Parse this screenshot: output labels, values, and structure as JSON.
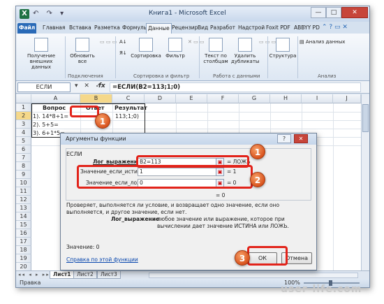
{
  "window": {
    "title": "Книга1 - Microsoft Excel",
    "app_icon_letter": "X",
    "qat_glyphs": "↶ ↷ ▾",
    "minimize": "—",
    "maximize": "□",
    "close": "✕"
  },
  "ribbon": {
    "tabs": [
      "Файл",
      "Главная",
      "Вставка",
      "Разметка",
      "Формулы",
      "Данные",
      "Рецензир",
      "Вид",
      "Разработ",
      "Надстрой",
      "Foxit PDF",
      "ABBYY PD"
    ],
    "active_tab": "Данные",
    "help_glyphs": "⌃ ? ▭ ✕",
    "buttons": {
      "get_external": "Получение внешних данных",
      "refresh_all": "Обновить все",
      "sort": "Сортировка",
      "filter": "Фильтр",
      "text_to_columns": "Текст по столбцам",
      "remove_duplicates": "Удалить дубликаты",
      "structure": "Структура",
      "data_analysis": "Анализ данных"
    },
    "groups": {
      "connections": "Подключения",
      "sort_filter": "Сортировка и фильтр",
      "data_tools": "Работа с данными",
      "analysis": "Анализ"
    }
  },
  "formula_bar": {
    "name_box": "ЕСЛИ",
    "buttons": "▾ ✕ ✓",
    "fx": "fx",
    "formula": "=ЕСЛИ(B2=113;1;0)"
  },
  "grid": {
    "columns": [
      "A",
      "B",
      "C",
      "D",
      "E",
      "F",
      "G",
      "H",
      "I",
      "J"
    ],
    "rows": [
      "1",
      "2",
      "3",
      "4",
      "5",
      "6",
      "7",
      "8",
      "9",
      "10",
      "11",
      "12",
      "13",
      "14",
      "15",
      "16",
      "17",
      "18",
      "19",
      "20"
    ],
    "header_row": {
      "a": "Вопрос",
      "b": "Ответ",
      "c": "Результат"
    },
    "cells": {
      "a2": "1). 14*8+1=",
      "c2": "113;1;0)",
      "a3": "2). 5+5=",
      "a4": "3). 6+1*5="
    }
  },
  "sheets": {
    "nav": "◂◂ ◂ ▸ ▸▸",
    "tabs": [
      "Лист1",
      "Лист2",
      "Лист3"
    ]
  },
  "status_bar": {
    "mode": "Правка",
    "zoom": "100%"
  },
  "dialog": {
    "title": "Аргументы функции",
    "help_btn": "?",
    "close_btn": "✕",
    "function_name": "ЕСЛИ",
    "args": [
      {
        "label": "Лог_выражение",
        "value": "B2=113",
        "result": "=  ЛОЖЬ"
      },
      {
        "label": "Значение_если_истина",
        "value": "1",
        "result": "=  1"
      },
      {
        "label": "Значение_если_ложь",
        "value": "0",
        "result": "=  0"
      }
    ],
    "overall_result": "=  0",
    "description": "Проверяет, выполняется ли условие, и возвращает одно значение, если оно выполняется, и другое значение, если нет.",
    "arg_help_label": "Лог_выражение",
    "arg_help_text": "любое значение или выражение, которое при вычислении дает значение ИСТИНА или ЛОЖЬ.",
    "value_line": "Значение:  0",
    "help_link": "Справка по этой функции",
    "ok": "ОК",
    "cancel": "Отмена"
  },
  "callouts": [
    "1",
    "1",
    "2",
    "3"
  ],
  "watermark": "user-life.com",
  "accent_color": "#e2231a"
}
